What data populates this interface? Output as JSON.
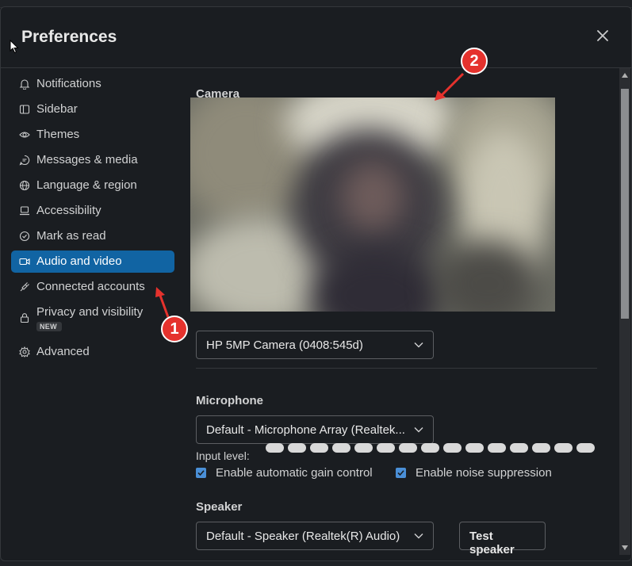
{
  "dialog": {
    "title": "Preferences",
    "close_icon": "close-icon"
  },
  "sidebar": {
    "items": [
      {
        "label": "Notifications",
        "icon": "bell-icon"
      },
      {
        "label": "Sidebar",
        "icon": "sidebar-icon"
      },
      {
        "label": "Themes",
        "icon": "eye-icon"
      },
      {
        "label": "Messages & media",
        "icon": "message-icon"
      },
      {
        "label": "Language & region",
        "icon": "globe-icon"
      },
      {
        "label": "Accessibility",
        "icon": "laptop-icon"
      },
      {
        "label": "Mark as read",
        "icon": "check-circle-icon"
      },
      {
        "label": "Audio and video",
        "icon": "video-icon",
        "active": true
      },
      {
        "label": "Connected accounts",
        "icon": "plug-icon"
      },
      {
        "label": "Privacy and visibility",
        "icon": "lock-icon",
        "badge": "NEW"
      },
      {
        "label": "Advanced",
        "icon": "gear-icon"
      }
    ]
  },
  "camera": {
    "label": "Camera",
    "device": "HP 5MP Camera (0408:545d)"
  },
  "microphone": {
    "label": "Microphone",
    "device": "Default - Microphone Array (Realtek...",
    "input_level_label": "Input level:",
    "agc_label": "Enable automatic gain control",
    "agc_checked": true,
    "noise_label": "Enable noise suppression",
    "noise_checked": true
  },
  "speaker": {
    "label": "Speaker",
    "device": "Default - Speaker (Realtek(R) Audio)",
    "test_button": "Test speaker"
  },
  "annotations": {
    "marker_1": "1",
    "marker_2": "2"
  },
  "colors": {
    "accent": "#1164a3",
    "annotation": "#e5322d",
    "checkbox": "#4a8fd7"
  }
}
